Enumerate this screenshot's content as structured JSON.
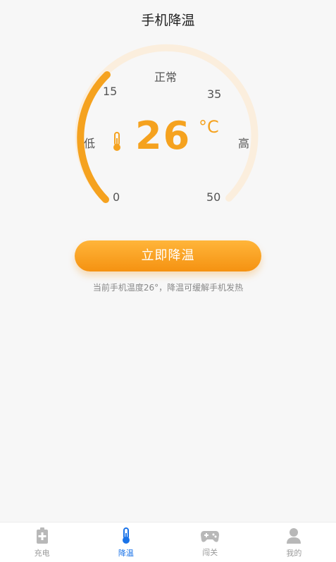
{
  "header": {
    "title": "手机降温"
  },
  "gauge": {
    "status_label": "正常",
    "scale": {
      "min": "0",
      "low_mark": "15",
      "high_mark": "35",
      "max": "50"
    },
    "low_label": "低",
    "high_label": "高",
    "temperature": "26",
    "unit": "°C",
    "level_fraction": 0.52,
    "accent_color": "#f5a21f",
    "track_color": "#fbeedd"
  },
  "action": {
    "button_label": "立即降温",
    "hint": "当前手机温度26°，降温可缓解手机发热"
  },
  "tabbar": {
    "items": [
      {
        "label": "充电",
        "icon": "battery-charge-icon",
        "active": false
      },
      {
        "label": "降温",
        "icon": "thermometer-icon",
        "active": true
      },
      {
        "label": "闯关",
        "icon": "gamepad-icon",
        "active": false
      },
      {
        "label": "我的",
        "icon": "user-icon",
        "active": false
      }
    ]
  }
}
